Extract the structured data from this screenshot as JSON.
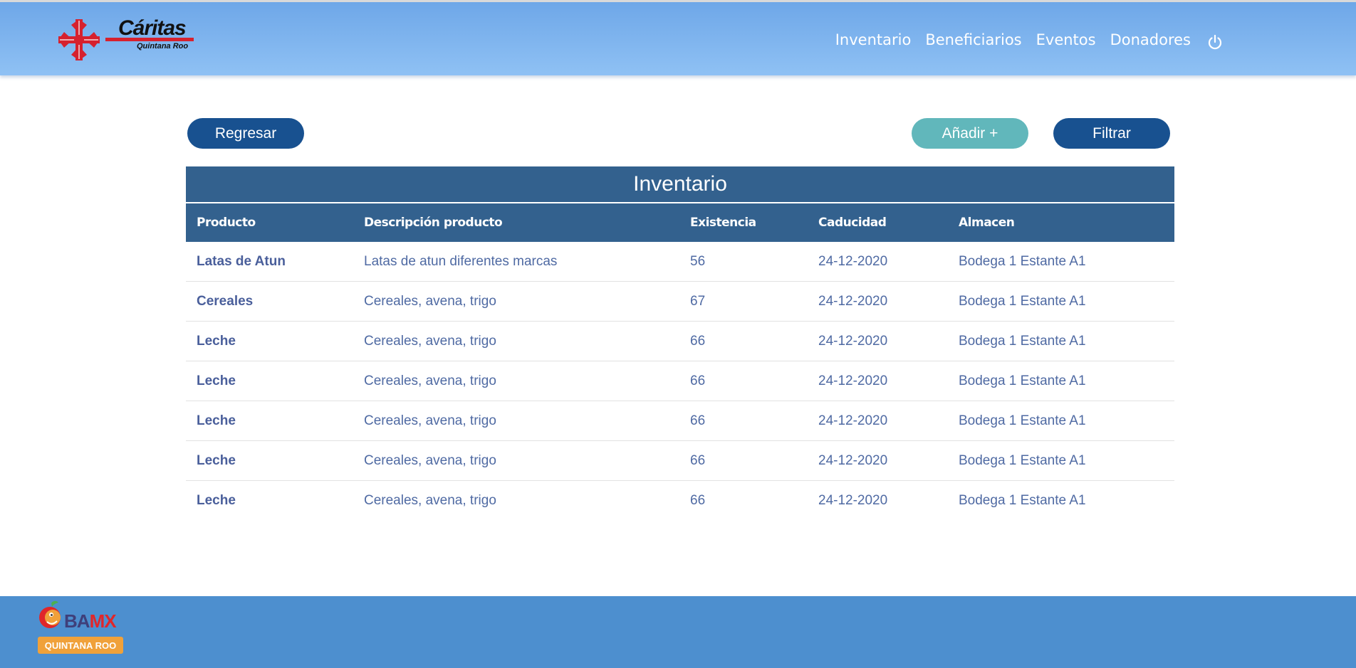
{
  "brand": {
    "logo_name": "Cáritas",
    "logo_sub": "Quintana Roo",
    "cross_color": "#d6212e"
  },
  "nav": {
    "items": [
      {
        "label": "Inventario"
      },
      {
        "label": "Beneficiarios"
      },
      {
        "label": "Eventos"
      },
      {
        "label": "Donadores"
      }
    ],
    "power_icon": "power-icon"
  },
  "actions": {
    "back_label": "Regresar",
    "add_label": "Añadir +",
    "filter_label": "Filtrar"
  },
  "table": {
    "title": "Inventario",
    "columns": [
      "Producto",
      "Descripción producto",
      "Existencia",
      "Caducidad",
      "Almacen"
    ],
    "rows": [
      [
        "Latas de Atun",
        "Latas de atun diferentes marcas",
        "56",
        "24-12-2020",
        "Bodega 1 Estante A1"
      ],
      [
        "Cereales",
        "Cereales, avena, trigo",
        "67",
        "24-12-2020",
        "Bodega 1 Estante A1"
      ],
      [
        "Leche",
        "Cereales, avena, trigo",
        "66",
        "24-12-2020",
        "Bodega 1 Estante A1"
      ],
      [
        "Leche",
        "Cereales, avena, trigo",
        "66",
        "24-12-2020",
        "Bodega 1 Estante A1"
      ],
      [
        "Leche",
        "Cereales, avena, trigo",
        "66",
        "24-12-2020",
        "Bodega 1 Estante A1"
      ],
      [
        "Leche",
        "Cereales, avena, trigo",
        "66",
        "24-12-2020",
        "Bodega 1 Estante A1"
      ],
      [
        "Leche",
        "Cereales, avena, trigo",
        "66",
        "24-12-2020",
        "Bodega 1 Estante A1"
      ]
    ]
  },
  "footer": {
    "logo_word_a": "BA",
    "logo_word_b": "MX",
    "logo_badge": "QUINTANA ROO"
  },
  "colors": {
    "primary": "#185190",
    "accent": "#61b7bb",
    "table_header": "#33618e",
    "footer": "#4d8fcf"
  }
}
